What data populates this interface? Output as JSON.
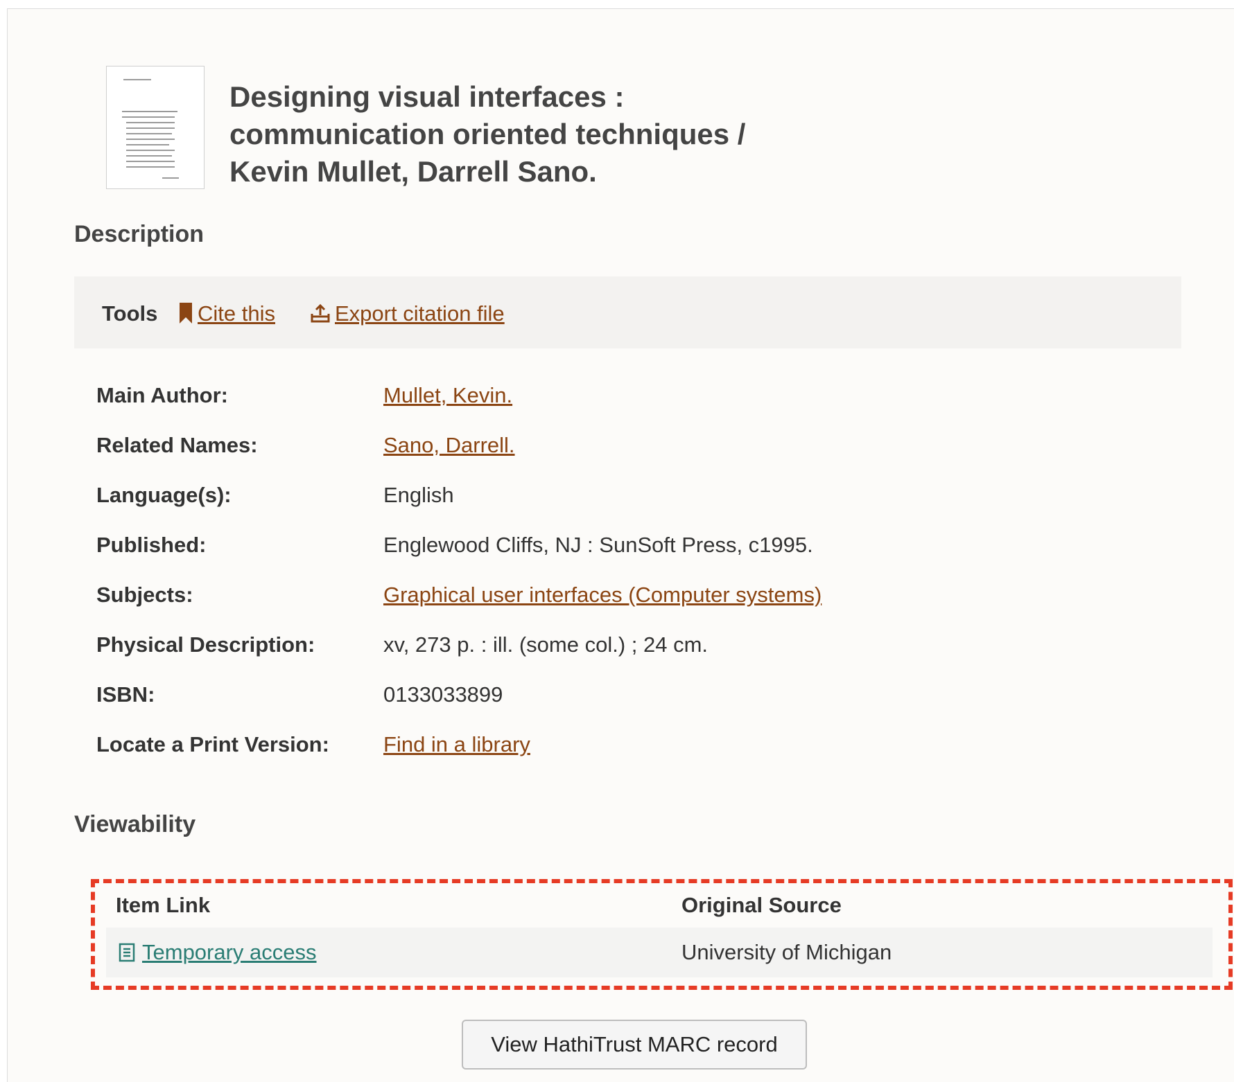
{
  "record": {
    "title": "Designing visual interfaces : communication oriented techniques / Kevin Mullet, Darrell Sano."
  },
  "description": {
    "heading": "Description",
    "tools": {
      "label": "Tools",
      "cite": "Cite this",
      "export": "Export citation file",
      "cite_icon": "bookmark-icon",
      "export_icon": "export-icon"
    },
    "fields": [
      {
        "label": "Main Author:",
        "value": "Mullet, Kevin.",
        "link": true
      },
      {
        "label": "Related Names:",
        "value": "Sano, Darrell.",
        "link": true
      },
      {
        "label": "Language(s):",
        "value": "English",
        "link": false
      },
      {
        "label": "Published:",
        "value": "Englewood Cliffs, NJ : SunSoft Press, c1995.",
        "link": false
      },
      {
        "label": "Subjects:",
        "value": "Graphical user interfaces (Computer systems)",
        "link": true
      },
      {
        "label": "Physical Description:",
        "value": "xv, 273 p. : ill. (some col.) ; 24 cm.",
        "link": false
      },
      {
        "label": "ISBN:",
        "value": "0133033899",
        "link": false
      },
      {
        "label": "Locate a Print Version:",
        "value": "Find in a library",
        "link": true
      }
    ]
  },
  "viewability": {
    "heading": "Viewability",
    "columns": [
      "Item Link",
      "Original Source"
    ],
    "rows": [
      {
        "item_link": "Temporary access",
        "source": "University of Michigan",
        "icon": "document-icon"
      }
    ]
  },
  "actions": {
    "marc_button": "View HathiTrust MARC record"
  },
  "colors": {
    "link": "#8b4513",
    "item_link": "#2a7d74",
    "highlight_border": "#e63b25",
    "background": "#fcfbf9"
  }
}
